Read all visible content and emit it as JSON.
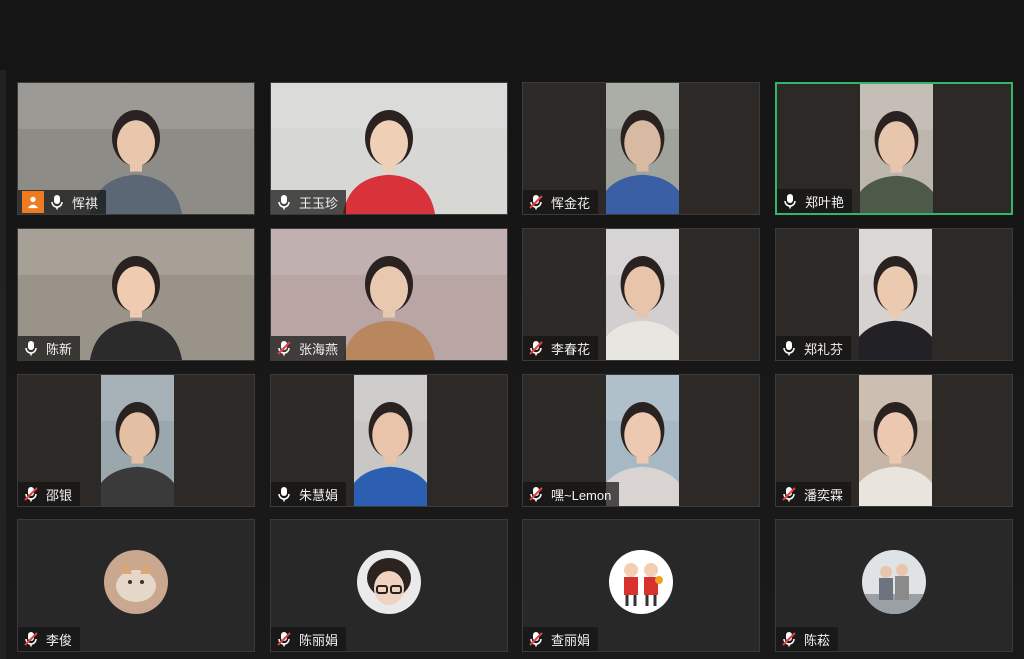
{
  "participants": [
    {
      "name": "恽祺",
      "muted": false,
      "host": true,
      "view": "full",
      "bg": "#8e8c87",
      "skin": "#e8c7ad",
      "shirt": "#5b6775"
    },
    {
      "name": "王玉珍",
      "muted": false,
      "host": false,
      "view": "full",
      "bg": "#d7d7d4",
      "skin": "#efcfb5",
      "shirt": "#d8323b"
    },
    {
      "name": "恽金花",
      "muted": true,
      "host": false,
      "view": "center",
      "bg": "#9fa39b",
      "skin": "#d8b9a2",
      "shirt": "#3a5fa4"
    },
    {
      "name": "郑叶艳",
      "muted": false,
      "host": false,
      "view": "center",
      "bg": "#bdb6ad",
      "skin": "#e8c6ad",
      "shirt": "#4d5a49",
      "active": true
    },
    {
      "name": "陈新",
      "muted": false,
      "host": false,
      "view": "full",
      "bg": "#9a9389",
      "skin": "#eecbb1",
      "shirt": "#2b2b2c"
    },
    {
      "name": "张海燕",
      "muted": true,
      "host": false,
      "view": "full",
      "bg": "#b8a5a4",
      "skin": "#e9c8b0",
      "shirt": "#b9875e"
    },
    {
      "name": "李春花",
      "muted": true,
      "host": false,
      "view": "center",
      "bg": "#d2cfd1",
      "skin": "#e7c4aa",
      "shirt": "#e8e6e0"
    },
    {
      "name": "郑礼芬",
      "muted": false,
      "host": false,
      "view": "center",
      "bg": "#d5d2cf",
      "skin": "#ebcab0",
      "shirt": "#222226"
    },
    {
      "name": "邵银",
      "muted": true,
      "host": false,
      "view": "center",
      "bg": "#9aa7ad",
      "skin": "#e3bfa4",
      "shirt": "#3a3a3a"
    },
    {
      "name": "朱慧娟",
      "muted": false,
      "host": false,
      "view": "center",
      "bg": "#c9c7c5",
      "skin": "#e9c4aa",
      "shirt": "#2c5fb1"
    },
    {
      "name": "嘿~Lemon",
      "muted": true,
      "host": false,
      "view": "center",
      "bg": "#a6b8c3",
      "skin": "#ecc9b0",
      "shirt": "#d9d4d2"
    },
    {
      "name": "潘奕霖",
      "muted": true,
      "host": false,
      "view": "center",
      "bg": "#c5b6a7",
      "skin": "#ecc8b0",
      "shirt": "#e9e4de"
    },
    {
      "name": "李俊",
      "muted": true,
      "host": false,
      "view": "avatar",
      "avatar": "cat-avatar"
    },
    {
      "name": "陈丽娟",
      "muted": true,
      "host": false,
      "view": "avatar",
      "avatar": "child-avatar"
    },
    {
      "name": "查丽娟",
      "muted": true,
      "host": false,
      "view": "avatar",
      "avatar": "cartoon-couple-avatar"
    },
    {
      "name": "陈菘",
      "muted": true,
      "host": false,
      "view": "avatar",
      "avatar": "couple-photo-avatar"
    }
  ],
  "colors": {
    "active_border": "#2fb66a",
    "host_badge": "#ee7b22",
    "muted_slash": "#e04040"
  }
}
